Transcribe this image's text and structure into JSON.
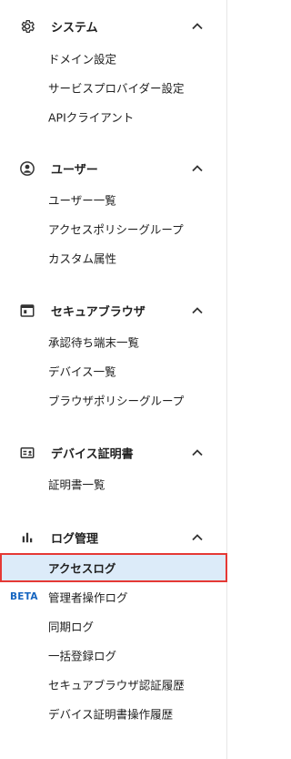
{
  "colors": {
    "text": "#212121",
    "icon": "#333333",
    "active_bg": "#dcebf9",
    "active_outline": "#e53935",
    "beta": "#1565c0"
  },
  "sections": [
    {
      "title": "システム",
      "icon": "gear-icon",
      "expanded": true,
      "items": [
        {
          "label": "ドメイン設定"
        },
        {
          "label": "サービスプロバイダー設定"
        },
        {
          "label": "APIクライアント"
        }
      ]
    },
    {
      "title": "ユーザー",
      "icon": "user-circle-icon",
      "expanded": true,
      "items": [
        {
          "label": "ユーザー一覧"
        },
        {
          "label": "アクセスポリシーグループ"
        },
        {
          "label": "カスタム属性"
        }
      ]
    },
    {
      "title": "セキュアブラウザ",
      "icon": "browser-window-icon",
      "expanded": true,
      "items": [
        {
          "label": "承認待ち端末一覧"
        },
        {
          "label": "デバイス一覧"
        },
        {
          "label": "ブラウザポリシーグループ"
        }
      ]
    },
    {
      "title": "デバイス証明書",
      "icon": "certificate-card-icon",
      "expanded": true,
      "items": [
        {
          "label": "証明書一覧"
        }
      ]
    },
    {
      "title": "ログ管理",
      "icon": "bar-chart-icon",
      "expanded": true,
      "items": [
        {
          "label": "アクセスログ",
          "active": true
        },
        {
          "label": "管理者操作ログ",
          "badge": "BETA"
        },
        {
          "label": "同期ログ"
        },
        {
          "label": "一括登録ログ"
        },
        {
          "label": "セキュアブラウザ認証履歴"
        },
        {
          "label": "デバイス証明書操作履歴"
        }
      ]
    }
  ]
}
